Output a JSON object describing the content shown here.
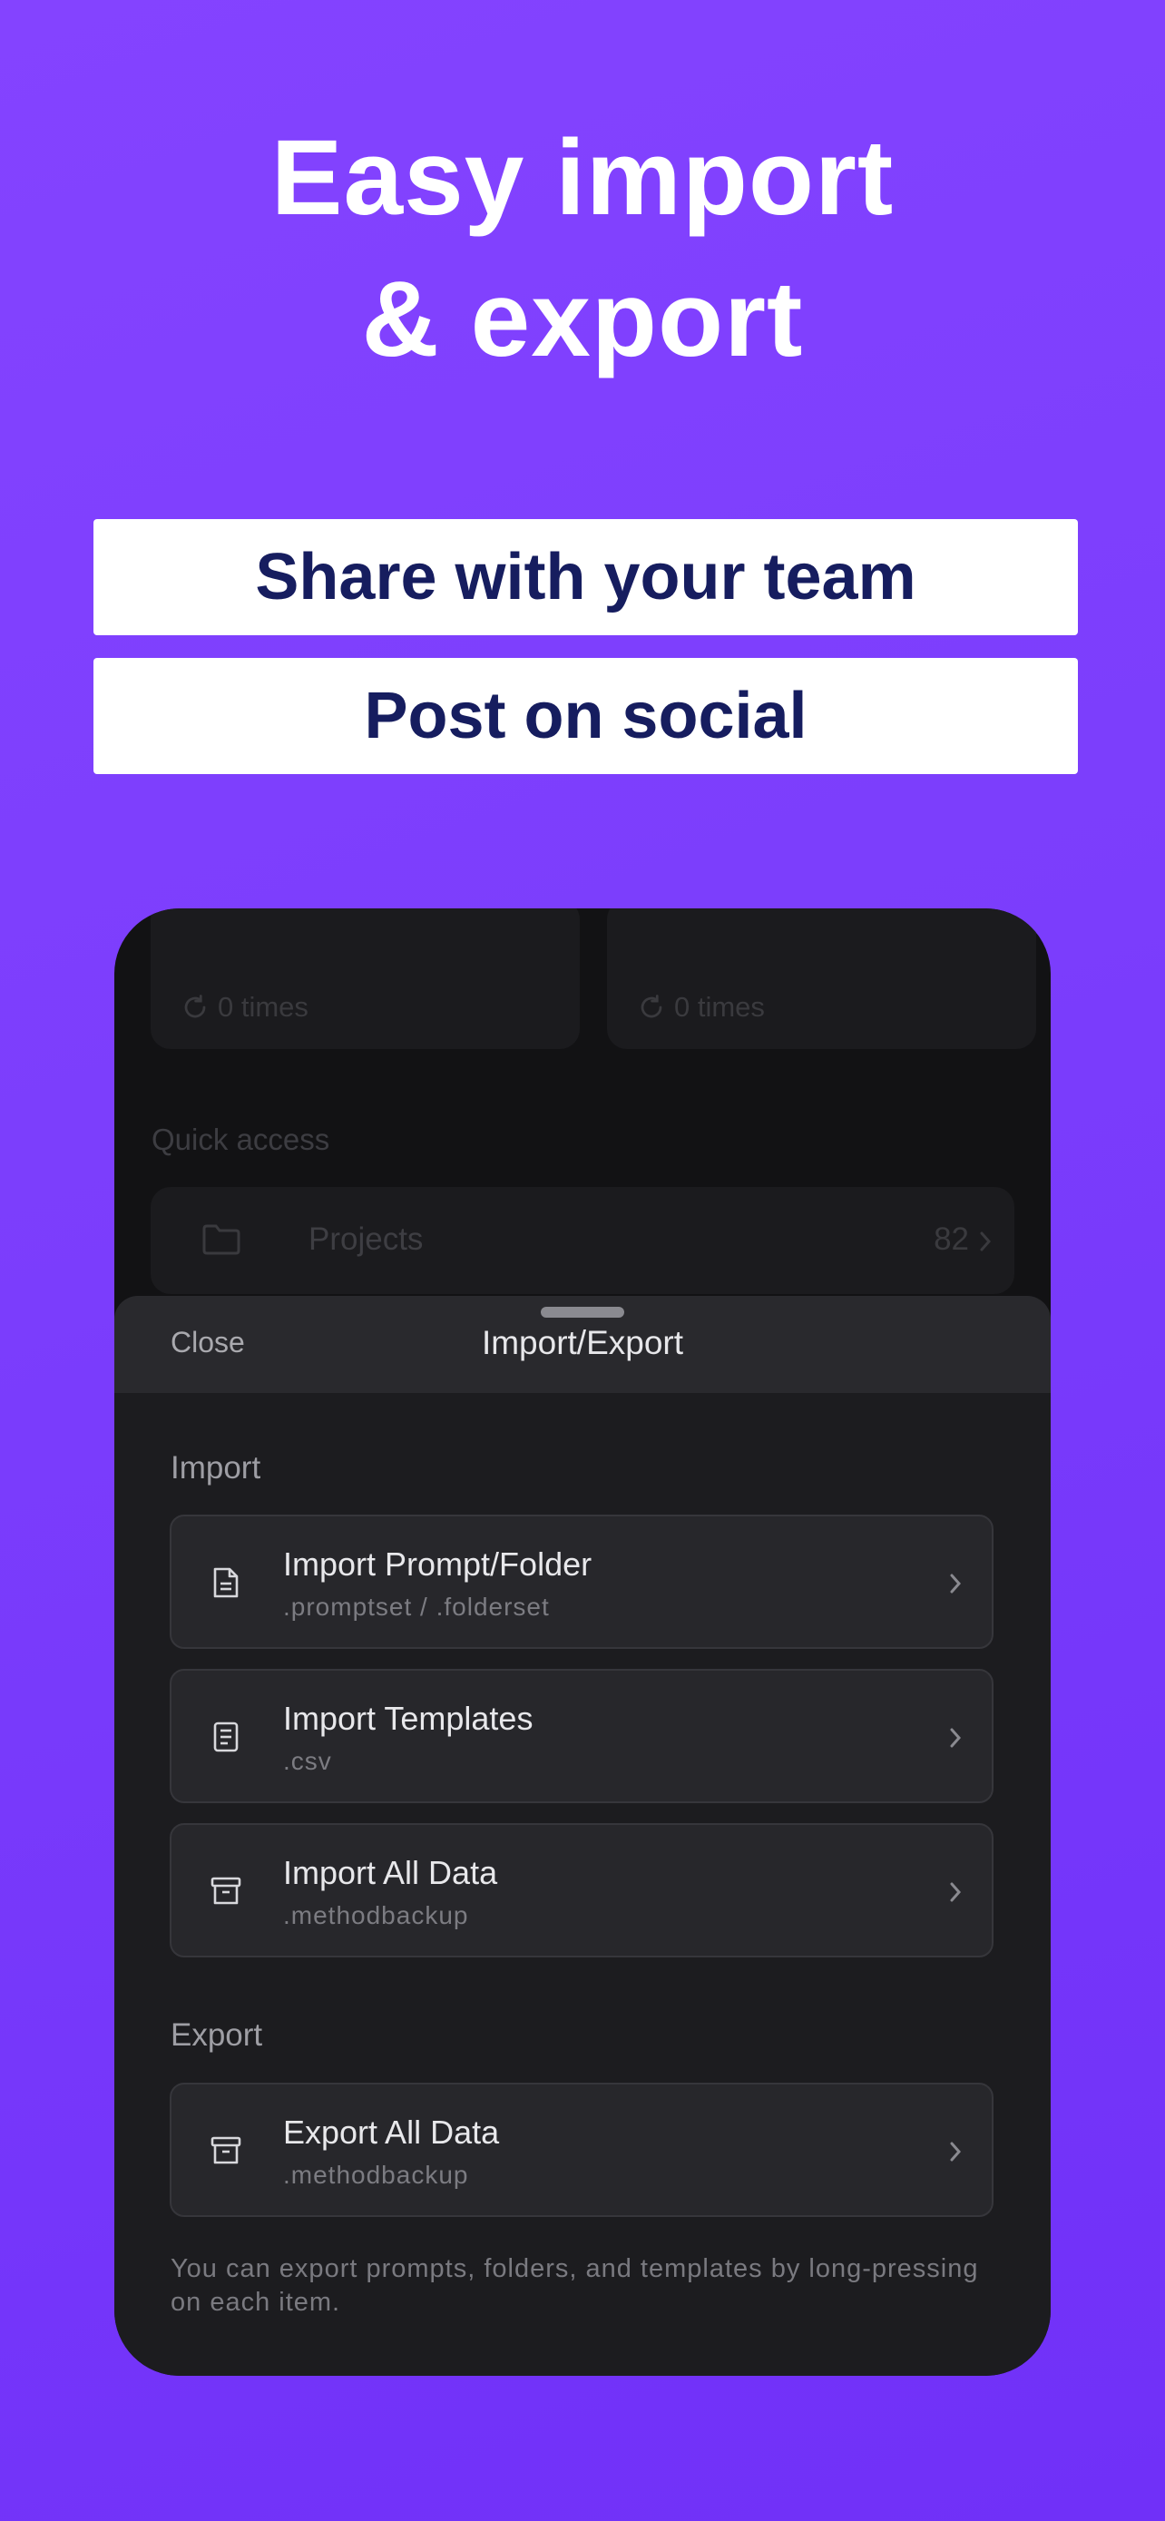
{
  "headline": {
    "line1": "Easy import",
    "line2": "& export"
  },
  "pills": {
    "share": "Share with your team",
    "social": "Post on social"
  },
  "background": {
    "card1_times": "0 times",
    "card2_times": "0 times",
    "quick_access_label": "Quick access",
    "projects_label": "Projects",
    "projects_count": "82"
  },
  "sheet": {
    "close_label": "Close",
    "title": "Import/Export",
    "import_section": "Import",
    "export_section": "Export",
    "import_items": [
      {
        "title": "Import Prompt/Folder",
        "subtitle": ".promptset / .folderset",
        "icon": "document-icon"
      },
      {
        "title": "Import Templates",
        "subtitle": ".csv",
        "icon": "template-icon"
      },
      {
        "title": "Import All Data",
        "subtitle": ".methodbackup",
        "icon": "archive-icon"
      }
    ],
    "export_items": [
      {
        "title": "Export All Data",
        "subtitle": ".methodbackup",
        "icon": "archive-icon"
      }
    ],
    "footnote": "You can export prompts, folders, and templates by long-pressing on each item."
  },
  "colors": {
    "background": "#7b3dfc",
    "pill_text": "#161d5f",
    "sheet": "#1c1c1f"
  }
}
